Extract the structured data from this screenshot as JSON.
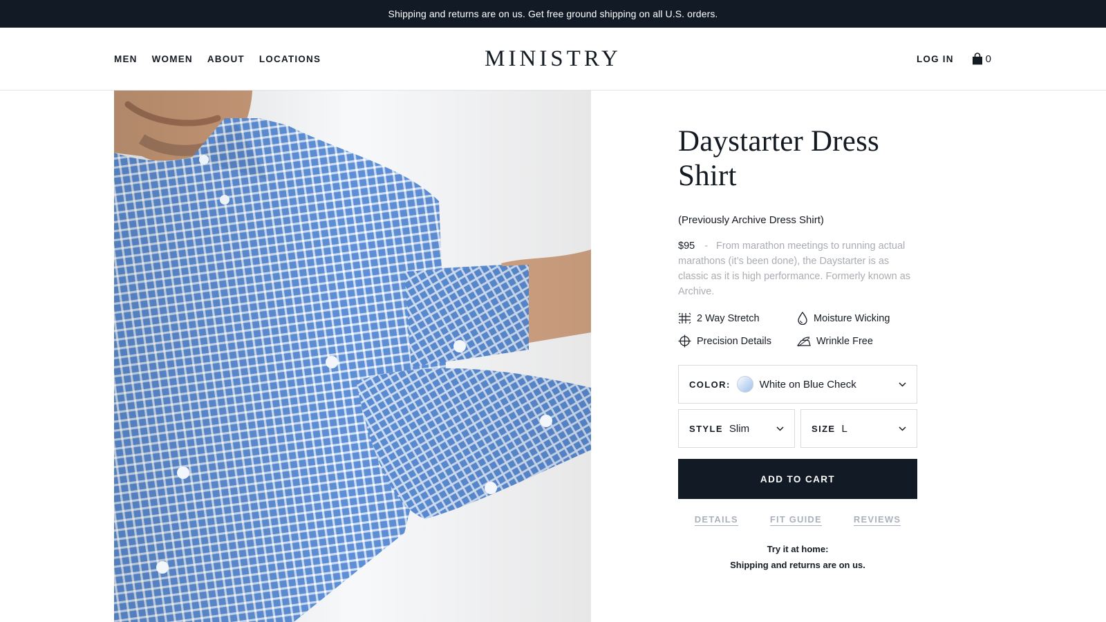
{
  "promo": {
    "text": "Shipping and returns are on us. Get free ground shipping on all U.S. orders."
  },
  "nav": {
    "left": [
      "MEN",
      "WOMEN",
      "ABOUT",
      "LOCATIONS"
    ],
    "logo": "MINISTRY",
    "login": "LOG IN",
    "cart_icon": "shopping-bag-icon",
    "cart_count": "0"
  },
  "product": {
    "title": "Daystarter Dress Shirt",
    "subtitle": "(Previously Archive Dress Shirt)",
    "price": "$95",
    "separator": "-",
    "description": "From marathon meetings to running actual marathons (it’s been done), the Daystarter is as classic as it is high performance. Formerly known as Archive.",
    "features": [
      {
        "label": "2 Way Stretch",
        "icon": "stretch-grid-icon"
      },
      {
        "label": "Moisture Wicking",
        "icon": "droplet-icon"
      },
      {
        "label": "Precision Details",
        "icon": "crosshair-icon"
      },
      {
        "label": "Wrinkle Free",
        "icon": "iron-icon"
      }
    ],
    "color": {
      "label": "COLOR:",
      "value": "White on Blue Check"
    },
    "style": {
      "label": "STYLE",
      "value": "Slim"
    },
    "size": {
      "label": "SIZE",
      "value": "L"
    },
    "add_to_cart": "ADD TO CART",
    "tabs": [
      "DETAILS",
      "FIT GUIDE",
      "REVIEWS"
    ],
    "try_home_line1": "Try it at home:",
    "try_home_line2": "Shipping and returns are on us."
  },
  "colors": {
    "navy": "#121a26",
    "muted_text": "#a9adb3",
    "link_muted": "#a9b1bd",
    "shirt_blue": "#5b8bd0"
  }
}
